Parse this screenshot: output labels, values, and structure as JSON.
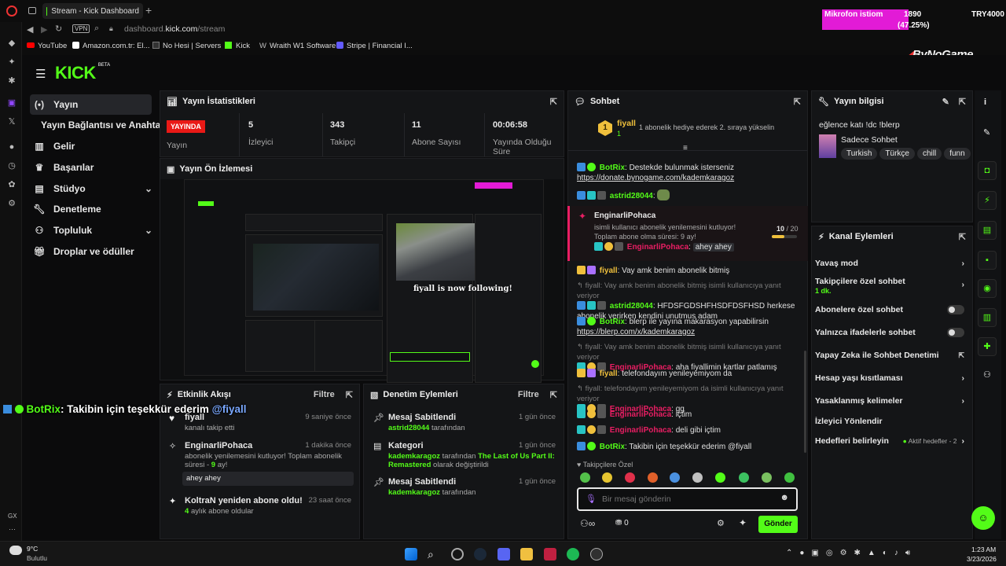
{
  "browser": {
    "tab_title": "Stream - Kick Dashboard",
    "vpn": "VPN",
    "url_prefix": "dashboard.",
    "url_host": "kick.com",
    "url_path": "/stream",
    "bookmarks": [
      "YouTube",
      "Amazon.com.tr: El...",
      "No Hesi | Servers",
      "Kick",
      "Wraith W1 Software",
      "Stripe | Financial I..."
    ],
    "gx_label": "GX"
  },
  "overlay": {
    "goal_label": "Mikrofon istiom",
    "goal_value": "1890",
    "goal_percent": "(47.25%)",
    "currency": "TRY4000",
    "logo_text": "ByNoGame",
    "botrix_name": "BotRix",
    "botrix_message": ": Takibin için teşekkür ederim",
    "botrix_mention": "@fiyall"
  },
  "kick": {
    "logo": "KICK",
    "beta": "BETA"
  },
  "nav": {
    "items": [
      {
        "label": "Yayın",
        "icon": "broadcast-icon"
      },
      {
        "label": "Yayın Bağlantısı ve Anahtarı",
        "icon": ""
      },
      {
        "label": "Gelir",
        "icon": "chart-icon"
      },
      {
        "label": "Başarılar",
        "icon": "trophy-icon"
      },
      {
        "label": "Stüdyo",
        "icon": "studio-icon"
      },
      {
        "label": "Denetleme",
        "icon": "wrench-icon"
      },
      {
        "label": "Topluluk",
        "icon": "people-icon"
      },
      {
        "label": "Droplar ve ödüller",
        "icon": "gift-icon"
      }
    ]
  },
  "stats": {
    "title": "Yayın İstatistikleri",
    "live_badge": "YAYINDA",
    "stream_label": "Yayın",
    "viewers_value": "5",
    "viewers_label": "İzleyici",
    "followers_value": "343",
    "followers_label": "Takipçi",
    "subs_value": "11",
    "subs_label": "Abone Sayısı",
    "uptime_value": "00:06:58",
    "uptime_label": "Yayında Olduğu Süre"
  },
  "preview": {
    "title": "Yayın Ön İzlemesi",
    "follow_text": "fiyall is now following!"
  },
  "activity": {
    "title": "Etkinlik Akışı",
    "filter": "Filtre",
    "items": [
      {
        "name": "fiyall",
        "time": "9 saniye önce",
        "desc": "kanalı takip etti"
      },
      {
        "name": "EnginarliPohaca",
        "time": "1 dakika önce",
        "desc": "abonelik yenilemesini kutluyor! Toplam abonelik süresi -",
        "extra": "9",
        "extra_suffix": "ay!",
        "quote": "ahey ahey"
      },
      {
        "name": "KoltraN yeniden abone oldu!",
        "time": "23 saat önce",
        "count": "4",
        "desc": "aylık abone oldular"
      }
    ]
  },
  "modlog": {
    "title": "Denetim Eylemleri",
    "filter": "Filtre",
    "items": [
      {
        "title": "Mesaj Sabitlendi",
        "time": "1 gün önce",
        "user": "astrid28044",
        "desc": "tarafından"
      },
      {
        "title": "Kategori",
        "time": "1 gün önce",
        "user": "kademkaragoz",
        "desc": "tarafından",
        "game": "The Last of Us Part II: Remastered",
        "desc2": "olarak değiştirildi"
      },
      {
        "title": "Mesaj Sabitlendi",
        "time": "1 gün önce",
        "user": "kademkaragoz",
        "desc": "tarafından"
      }
    ]
  },
  "chat": {
    "title": "Sohbet",
    "gifter_name": "fiyall",
    "gifter_count": "1",
    "gifter_desc": "1 abonelik hediye ederek 2. sıraya yükselin",
    "sub_user": "EnginarliPohaca",
    "sub_text": "isimli kullanıcı abonelik yenilemesini kutluyor! Toplam abone olma süresi: 9 ay!",
    "sub_progress": "10",
    "sub_total": "/ 20",
    "sub_fraction": 0.5,
    "sub_sender": "EnginarliPohaca",
    "sub_msg": "ahey ahey",
    "messages": [
      {
        "user": "BotRix",
        "text": "Destekde bulunmak isterseniz",
        "link": "https://donate.bynogame.com/kademkaragoz"
      },
      {
        "user": "astrid28044",
        "text": ""
      },
      {
        "user": "fiyall",
        "text": "Vay amk benim abonelik bitmiş"
      },
      {
        "reply": "fiyall: Vay amk benim abonelik bitmiş isimli kullanıcıya yanıt veriyor",
        "user": "astrid28044",
        "text": "HFDSFGDSHFHSDFDSFHSD herkese abonelik verirken kendini unutmus adam"
      },
      {
        "user": "BotRix",
        "text": "blerp ile yayına makarasyon yapabilirsin",
        "link": "https://blerp.com/x/kademkaragoz"
      },
      {
        "reply": "fiyall: Vay amk benim abonelik bitmiş isimli kullanıcıya yanıt veriyor",
        "user": "EnginarliPohaca",
        "text": "aha fiyallimin kartlar patlamış"
      },
      {
        "user": "fiyall",
        "text": "telefondayım yenileyemiyom da"
      },
      {
        "reply": "fiyall: telefondayım yenileyemiyom da isimli kullanıcıya yanıt veriyor",
        "user": "EnginarliPohaca",
        "text": "gg"
      },
      {
        "user": "EnginarliPohaca",
        "text": "içtim"
      },
      {
        "user": "EnginarliPohaca",
        "text": "deli gibi içtim"
      },
      {
        "user": "BotRix",
        "text": "Takibin için teşekkür ederim @fiyall"
      }
    ],
    "emote_section": "Takipçilere Özel",
    "input_placeholder": "Bir mesaj gönderin",
    "points": "0",
    "send": "Gönder"
  },
  "streaminfo": {
    "title": "Yayın bilgisi",
    "stream_title": "eğlence katı !dc !blerp",
    "category": "Sadece Sohbet",
    "tags": [
      "Turkish",
      "Türkçe",
      "chill",
      "funn"
    ]
  },
  "actions": {
    "title": "Kanal Eylemleri",
    "items": [
      {
        "label": "Yavaş mod",
        "type": "chevron"
      },
      {
        "label": "Takipçilere özel sohbet",
        "sub": "1 dk.",
        "type": "chevron"
      },
      {
        "label": "Abonelere özel sohbet",
        "type": "toggle"
      },
      {
        "label": "Yalnızca ifadelerle sohbet",
        "type": "toggle"
      },
      {
        "label": "Yapay Zeka ile Sohbet Denetimi",
        "type": "external"
      },
      {
        "label": "Hesap yaşı kısıtlaması",
        "type": "chevron"
      },
      {
        "label": "Yasaklanmış kelimeler",
        "type": "chevron"
      },
      {
        "label": "İzleyici Yönlendir",
        "type": "none"
      },
      {
        "label": "Hedefleri belirleyin",
        "sub_inline": "Aktif hedefler - 2",
        "type": "chevron"
      }
    ]
  },
  "taskbar": {
    "weather_temp": "9°C",
    "weather_desc": "Bulutlu",
    "time": "1:23 AM",
    "date": "3/23/2026"
  },
  "colors": {
    "kick_green": "#53fc18",
    "live_red": "#e91916",
    "gold": "#f0c03c",
    "goal_pink": "#e21bd6"
  }
}
